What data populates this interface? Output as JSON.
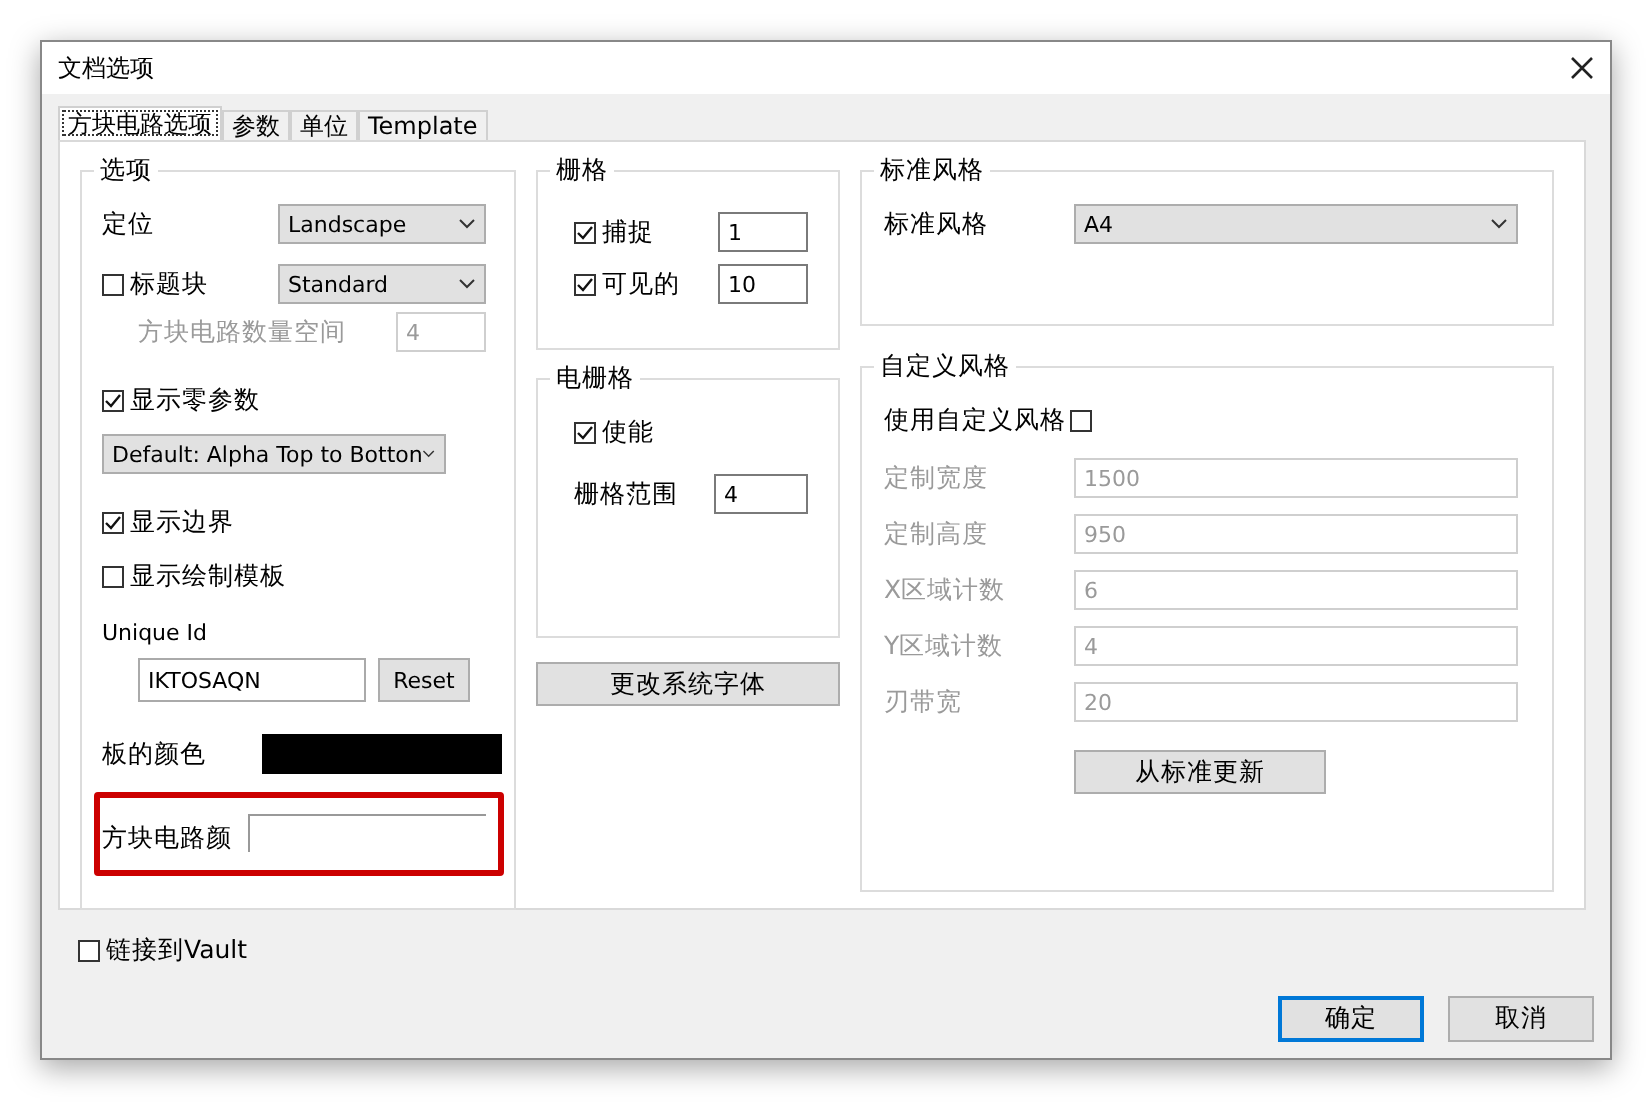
{
  "window": {
    "title": "文档选项"
  },
  "tabs": [
    {
      "label": "方块电路选项",
      "selected": true
    },
    {
      "label": "参数",
      "selected": false
    },
    {
      "label": "单位",
      "selected": false
    },
    {
      "label": "Template",
      "selected": false
    }
  ],
  "options": {
    "title": "选项",
    "orientation": {
      "label": "定位",
      "value": "Landscape"
    },
    "title_block": {
      "label": "标题块",
      "checked": false,
      "value": "Standard"
    },
    "sheet_number_space": {
      "label": "方块电路数量空间",
      "value": "4"
    },
    "show_zero_params": {
      "label": "显示零参数",
      "checked": true
    },
    "param_order": {
      "value": "Default: Alpha Top to Botton"
    },
    "show_border": {
      "label": "显示边界",
      "checked": true
    },
    "show_template": {
      "label": "显示绘制模板",
      "checked": false
    },
    "unique_id": {
      "label": "Unique Id",
      "value": "IKTOSAQN",
      "button": "Reset"
    },
    "board_color": {
      "label": "板的颜色",
      "color": "#000000"
    },
    "sheet_color": {
      "label": "方块电路颜"
    }
  },
  "grid": {
    "title": "栅格",
    "items": [
      {
        "label": "捕捉",
        "checked": true,
        "value": "1"
      },
      {
        "label": "可见的",
        "checked": true,
        "value": "10"
      }
    ]
  },
  "electrical_grid": {
    "title": "电栅格",
    "enable": {
      "label": "使能",
      "checked": true
    },
    "range": {
      "label": "栅格范围",
      "value": "4"
    }
  },
  "change_font_button": "更改系统字体",
  "standard_style": {
    "title": "标准风格",
    "label": "标准风格",
    "value": "A4"
  },
  "custom_style": {
    "title": "自定义风格",
    "use_custom": {
      "label": "使用自定义风格",
      "checked": false
    },
    "fields": [
      {
        "label": "定制宽度",
        "value": "1500"
      },
      {
        "label": "定制高度",
        "value": "950"
      },
      {
        "label": "X区域计数",
        "value": "6"
      },
      {
        "label": "Y区域计数",
        "value": "4"
      },
      {
        "label": "刃带宽",
        "value": "20"
      }
    ],
    "button": "从标准更新"
  },
  "link_vault": {
    "label": "链接到Vault",
    "checked": false
  },
  "buttons": [
    {
      "label": "确定",
      "kind": "default"
    },
    {
      "label": "取消",
      "kind": "normal"
    }
  ]
}
